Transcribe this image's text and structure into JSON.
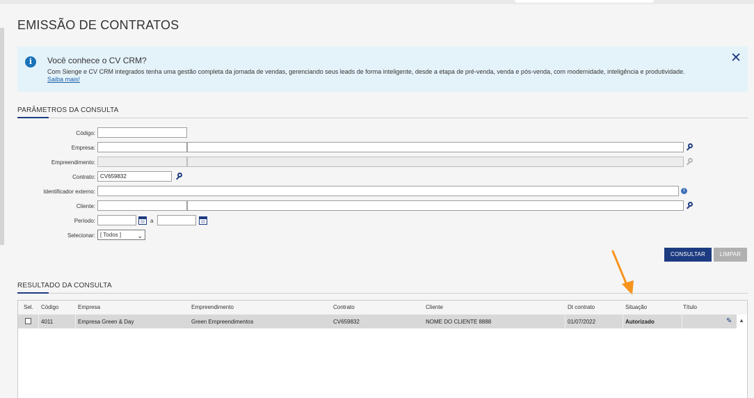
{
  "page": {
    "title": "EMISSÃO DE CONTRATOS"
  },
  "info": {
    "title": "Você conhece o CV CRM?",
    "message": "Com Sienge e CV CRM integrados tenha uma gestão completa da jornada de vendas, gerenciando seus leads de forma inteligente, desde a etapa de pré-venda, venda e pós-venda, com modernidade, inteligência e produtividade.",
    "link": "Saiba mais!",
    "close": "✕"
  },
  "params": {
    "section_title": "PARÂMETROS DA CONSULTA",
    "codigo_label": "Código:",
    "empresa_label": "Empresa:",
    "empreendimento_label": "Empreendimento:",
    "contrato_label": "Contrato:",
    "contrato_value": "CV659832",
    "identificador_label": "Identificador externo:",
    "cliente_label": "Cliente:",
    "periodo_label": "Período:",
    "periodo_sep": "a",
    "selecionar_label": "Selecionar:",
    "selecionar_value": "[ Todos ]"
  },
  "actions": {
    "consultar": "CONSULTAR",
    "limpar": "LIMPAR"
  },
  "results": {
    "section_title": "RESULTADO DA CONSULTA",
    "columns": [
      "Sel.",
      "Código",
      "Empresa",
      "Empreendimento",
      "Contrato",
      "Cliente",
      "Dt contrato",
      "Situação",
      "Título"
    ],
    "rows": [
      {
        "codigo": "4011",
        "empresa": "Empresa Green & Day",
        "empreendimento": "Green Empreendimentos",
        "contrato": "CV659832",
        "cliente": "NOME DO CLIENTE 8888",
        "dt_contrato": "01/07/2022",
        "situacao": "Autorizado",
        "titulo": ""
      }
    ]
  },
  "colors": {
    "primary": "#1d3b80",
    "info_bg": "#e4f3fa",
    "annotation_arrow": "#f7941d"
  },
  "icons": {
    "info": "info-icon",
    "search": "search-icon",
    "calendar": "calendar-icon",
    "edit": "pencil-icon",
    "annotation": "arrow-icon"
  }
}
